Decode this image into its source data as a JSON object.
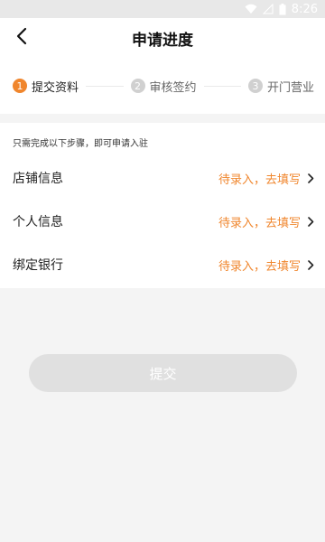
{
  "status_bar": {
    "time": "8:26"
  },
  "header": {
    "title": "申请进度"
  },
  "steps": [
    {
      "num": "1",
      "label": "提交资料",
      "state": "active"
    },
    {
      "num": "2",
      "label": "审核签约",
      "state": "inactive"
    },
    {
      "num": "3",
      "label": "开门营业",
      "state": "inactive"
    }
  ],
  "form": {
    "hint": "只需完成以下步骤，即可申请入驻",
    "rows": [
      {
        "label": "店铺信息",
        "status": "待录入，去填写"
      },
      {
        "label": "个人信息",
        "status": "待录入，去填写"
      },
      {
        "label": "绑定银行",
        "status": "待录入，去填写"
      }
    ]
  },
  "submit": {
    "label": "提交"
  },
  "colors": {
    "accent": "#f0862d",
    "disabled_button": "#e0e0e0"
  }
}
